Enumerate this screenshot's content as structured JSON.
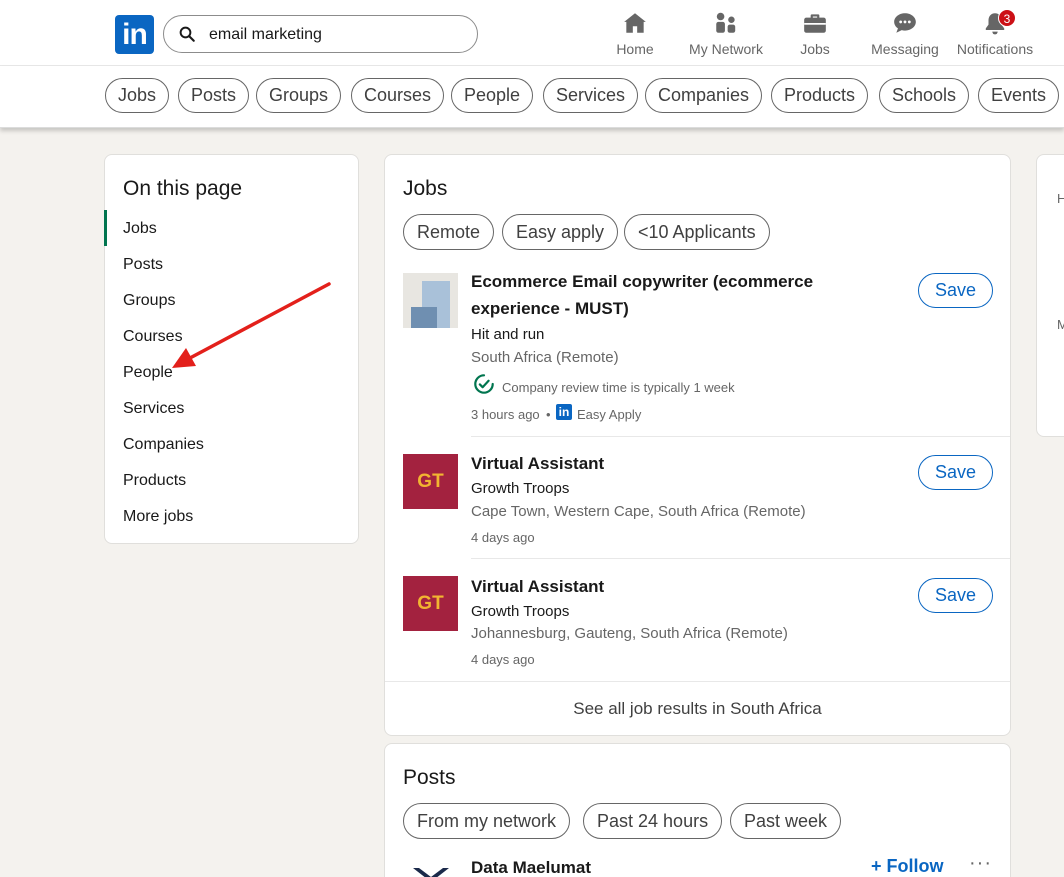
{
  "header": {
    "search_value": "email marketing",
    "nav": [
      {
        "label": "Home",
        "icon": "home-icon"
      },
      {
        "label": "My Network",
        "icon": "network-icon"
      },
      {
        "label": "Jobs",
        "icon": "briefcase-icon"
      },
      {
        "label": "Messaging",
        "icon": "messaging-icon"
      },
      {
        "label": "Notifications",
        "icon": "bell-icon",
        "badge": "3"
      }
    ]
  },
  "filters": [
    "Jobs",
    "Posts",
    "Groups",
    "Courses",
    "People",
    "Services",
    "Companies",
    "Products",
    "Schools",
    "Events"
  ],
  "on_this_page": {
    "title": "On this page",
    "items": [
      "Jobs",
      "Posts",
      "Groups",
      "Courses",
      "People",
      "Services",
      "Companies",
      "Products",
      "More jobs"
    ]
  },
  "jobs": {
    "title": "Jobs",
    "chips": [
      "Remote",
      "Easy apply",
      "<10 Applicants"
    ],
    "listings": [
      {
        "title": "Ecommerce Email copywriter (ecommerce experience - MUST)",
        "company": "Hit and run",
        "location": "South Africa (Remote)",
        "insight": "Company review time is typically 1 week",
        "posted": "3 hours ago",
        "separator": "•",
        "easy_apply": "Easy Apply",
        "save": "Save"
      },
      {
        "title": "Virtual Assistant",
        "company": "Growth Troops",
        "location": "Cape Town, Western Cape, South Africa (Remote)",
        "posted": "4 days ago",
        "logo_text": "GT",
        "save": "Save"
      },
      {
        "title": "Virtual Assistant",
        "company": "Growth Troops",
        "location": "Johannesburg, Gauteng, South Africa (Remote)",
        "posted": "4 days ago",
        "logo_text": "GT",
        "save": "Save"
      }
    ],
    "see_all": "See all job results in South Africa"
  },
  "posts": {
    "title": "Posts",
    "chips": [
      "From my network",
      "Past 24 hours",
      "Past week"
    ],
    "first_author": "Data Maelumat",
    "follow": "+ Follow",
    "more": "···"
  },
  "right_panel": {
    "letters": [
      "H",
      "M"
    ]
  },
  "colors": {
    "brand": "#0a66c2",
    "accent_green": "#01754f",
    "badge": "#cc1016",
    "annotation_arrow": "#e3201b"
  }
}
